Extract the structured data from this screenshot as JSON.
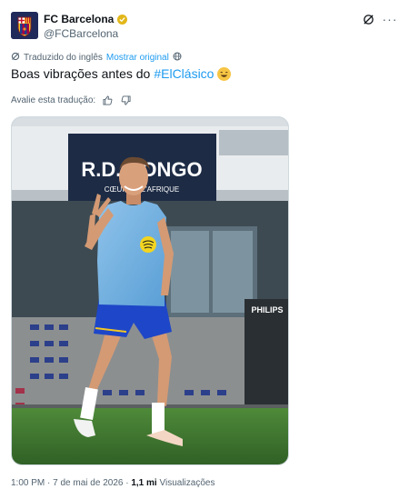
{
  "author": {
    "display_name": "FC Barcelona",
    "handle": "@FCBarcelona"
  },
  "translation": {
    "notice": "Traduzido do inglês",
    "show_original": "Mostrar original"
  },
  "tweet": {
    "text_before": "Boas vibrações antes do",
    "hashtag": "#ElClásico"
  },
  "rate": {
    "label": "Avalie esta tradução:"
  },
  "photo": {
    "sign_line1": "R.D. CONGO",
    "sign_line2": "CŒUR DE L'AFRIQUE",
    "board_text": "PHILIPS"
  },
  "meta": {
    "time": "1:00 PM",
    "sep1": "·",
    "date": "7 de mai de 2026",
    "sep2": "·",
    "views_count": "1,1 mi",
    "views_label": "Visualizações"
  },
  "colors": {
    "link": "#1d9bf0",
    "secondary_text": "#536471",
    "verified": "#e2b719",
    "crest_blue": "#1f2a5a"
  },
  "icons": [
    "verified-badge-icon",
    "grok-icon",
    "more-icon",
    "translate-icon",
    "globe-icon",
    "thumbs-up-icon",
    "thumbs-down-icon",
    "laughing-emoji-icon"
  ]
}
